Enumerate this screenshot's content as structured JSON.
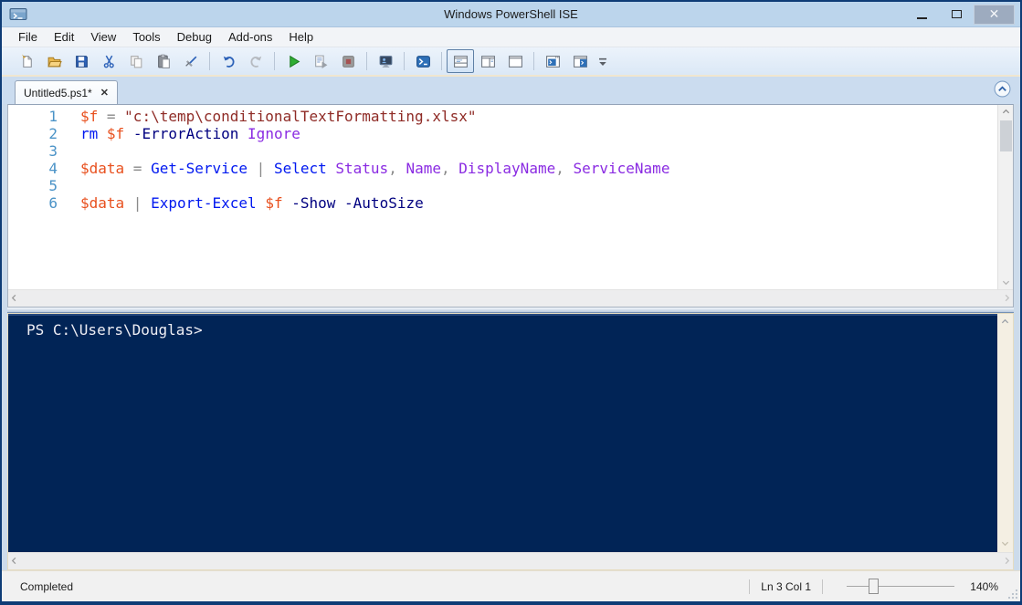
{
  "window": {
    "title": "Windows PowerShell ISE"
  },
  "title_bar": {
    "icons": [
      "powershell-app-icon",
      "minimize-icon",
      "maximize-icon",
      "close-icon"
    ],
    "close_glyph": "✕"
  },
  "menu": {
    "items": [
      "File",
      "Edit",
      "View",
      "Tools",
      "Debug",
      "Add-ons",
      "Help"
    ]
  },
  "toolbar": {
    "icons": [
      "new-script-icon",
      "open-script-icon",
      "save-icon",
      "cut-icon",
      "copy-icon",
      "paste-icon",
      "clear-console-pane-icon",
      "undo-icon",
      "redo-icon",
      "run-script-icon",
      "run-selection-icon",
      "stop-operation-icon",
      "new-remote-powershell-tab-icon",
      "start-powershell-icon",
      "show-script-pane-top-icon",
      "show-script-pane-right-icon",
      "show-script-pane-maximized-icon",
      "powershell-tab-icon",
      "powershell-window-icon",
      "toolbar-overflow-icon"
    ],
    "active_button": "show-script-pane-top"
  },
  "tabs": [
    {
      "label": "Untitled5.ps1*",
      "close_glyph": "✕",
      "selected": true
    }
  ],
  "editor": {
    "lines": [
      {
        "number": "1",
        "tokens": [
          {
            "c": "variable",
            "t": "$f"
          },
          {
            "c": "operator",
            "t": " = "
          },
          {
            "c": "string",
            "t": "\"c:\\temp\\conditionalTextFormatting.xlsx\""
          }
        ]
      },
      {
        "number": "2",
        "tokens": [
          {
            "c": "command",
            "t": "rm"
          },
          {
            "c": "plain",
            "t": " "
          },
          {
            "c": "variable",
            "t": "$f"
          },
          {
            "c": "plain",
            "t": " "
          },
          {
            "c": "parameter",
            "t": "-ErrorAction"
          },
          {
            "c": "plain",
            "t": " "
          },
          {
            "c": "argument",
            "t": "Ignore"
          }
        ]
      },
      {
        "number": "3",
        "tokens": []
      },
      {
        "number": "4",
        "tokens": [
          {
            "c": "variable",
            "t": "$data"
          },
          {
            "c": "operator",
            "t": " = "
          },
          {
            "c": "command",
            "t": "Get-Service"
          },
          {
            "c": "operator",
            "t": " | "
          },
          {
            "c": "command",
            "t": "Select"
          },
          {
            "c": "plain",
            "t": " "
          },
          {
            "c": "argument",
            "t": "Status"
          },
          {
            "c": "operator",
            "t": ", "
          },
          {
            "c": "argument",
            "t": "Name"
          },
          {
            "c": "operator",
            "t": ", "
          },
          {
            "c": "argument",
            "t": "DisplayName"
          },
          {
            "c": "operator",
            "t": ", "
          },
          {
            "c": "argument",
            "t": "ServiceName"
          }
        ]
      },
      {
        "number": "5",
        "tokens": []
      },
      {
        "number": "6",
        "tokens": [
          {
            "c": "variable",
            "t": "$data"
          },
          {
            "c": "operator",
            "t": " | "
          },
          {
            "c": "command",
            "t": "Export-Excel"
          },
          {
            "c": "plain",
            "t": " "
          },
          {
            "c": "variable",
            "t": "$f"
          },
          {
            "c": "plain",
            "t": " "
          },
          {
            "c": "parameter",
            "t": "-Show"
          },
          {
            "c": "plain",
            "t": " "
          },
          {
            "c": "parameter",
            "t": "-AutoSize"
          }
        ]
      }
    ]
  },
  "console": {
    "prompt": "PS C:\\Users\\Douglas>"
  },
  "status_bar": {
    "status": "Completed",
    "cursor_position": "Ln 3 Col 1",
    "zoom": "140%"
  },
  "colors": {
    "window_border": "#0e3c76",
    "title_bar_bg": "#bcd5ec",
    "console_bg": "#012456",
    "console_text": "#eeeef4",
    "token_variable": "#e8501e",
    "token_command": "#0018f0",
    "token_string": "#8f2b26",
    "token_parameter": "#000080",
    "token_argument": "#8a2be2",
    "token_operator": "#8a8a8a",
    "line_number": "#4b93c7",
    "pane_accent_border": "#e6dcc0"
  }
}
